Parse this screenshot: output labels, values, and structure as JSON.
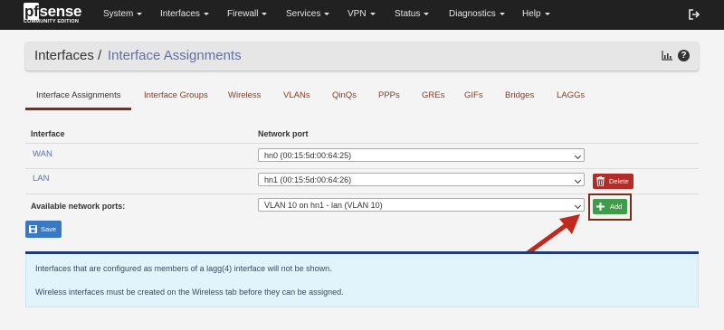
{
  "brand": {
    "logo_text": "pfsense",
    "logo_pf": "pf",
    "logo_rest": "sense",
    "edition": "COMMUNITY EDITION"
  },
  "nav": {
    "items": [
      {
        "label": "System"
      },
      {
        "label": "Interfaces"
      },
      {
        "label": "Firewall"
      },
      {
        "label": "Services"
      },
      {
        "label": "VPN"
      },
      {
        "label": "Status"
      },
      {
        "label": "Diagnostics"
      },
      {
        "label": "Help"
      }
    ],
    "logout_icon": "sign-out-icon"
  },
  "header": {
    "breadcrumb_root": "Interfaces /",
    "breadcrumb_current": "Interface Assignments",
    "chart_icon": "bar-chart-icon",
    "help_icon": "question-circle-icon",
    "help_glyph": "?"
  },
  "tabs": [
    {
      "label": "Interface Assignments",
      "active": true
    },
    {
      "label": "Interface Groups"
    },
    {
      "label": "Wireless"
    },
    {
      "label": "VLANs"
    },
    {
      "label": "QinQs"
    },
    {
      "label": "PPPs"
    },
    {
      "label": "GREs"
    },
    {
      "label": "GIFs"
    },
    {
      "label": "Bridges"
    },
    {
      "label": "LAGGs"
    }
  ],
  "table": {
    "columns": [
      "Interface",
      "Network port"
    ],
    "rows": [
      {
        "interface": "WAN",
        "port": "hn0 (00:15:5d:00:64:25)"
      },
      {
        "interface": "LAN",
        "port": "hn1 (00:15:5d:00:64:26)",
        "action": "Delete"
      }
    ],
    "available_label": "Available network ports:",
    "available_value": "VLAN 10 on hn1 - lan (VLAN 10)",
    "add_label": "Add"
  },
  "save_label": "Save",
  "info": {
    "lines": [
      "Interfaces that are configured as members of a lagg(4) interface will not be shown.",
      "Wireless interfaces must be created on the Wireless tab before they can be assigned."
    ]
  },
  "colors": {
    "navbar": "#212121",
    "link": "#6270a6",
    "tab_text": "#8c3a22",
    "delete_button": "#b52b27",
    "add_button": "#3e9c4a",
    "save_button": "#3b78c4",
    "info_background": "#e1f3fb",
    "annotation": "#7a2e17"
  }
}
